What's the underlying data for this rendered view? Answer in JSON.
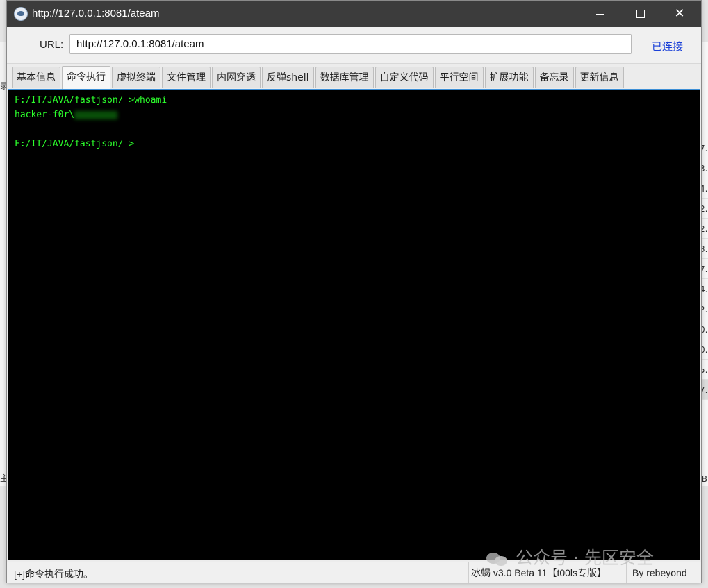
{
  "window": {
    "title": "http://127.0.0.1:8081/ateam",
    "icon": "shell-app-icon"
  },
  "urlbar": {
    "label": "URL:",
    "value": "http://127.0.0.1:8081/ateam",
    "status": "已连接",
    "status_color": "#1a40d8"
  },
  "tabs": [
    {
      "label": "基本信息"
    },
    {
      "label": "命令执行",
      "active": true
    },
    {
      "label": "虚拟终端"
    },
    {
      "label": "文件管理"
    },
    {
      "label": "内网穿透"
    },
    {
      "label": "反弹shell"
    },
    {
      "label": "数据库管理"
    },
    {
      "label": "自定义代码"
    },
    {
      "label": "平行空间"
    },
    {
      "label": "扩展功能"
    },
    {
      "label": "备忘录"
    },
    {
      "label": "更新信息"
    }
  ],
  "terminal": {
    "line1": "F:/IT/JAVA/fastjson/ >whoami",
    "line2": "hacker-f0r\\",
    "line3": "",
    "line4": "F:/IT/JAVA/fastjson/ >",
    "text_color": "#2cff2c",
    "background": "#000000"
  },
  "statusbar": {
    "message": "[+]命令执行成功。",
    "version": "冰蝎 v3.0 Beta 11【t00ls专版】",
    "author": "By rebeyond"
  },
  "background": {
    "left_labels": [
      "录",
      "主"
    ],
    "right_cells": [
      "7.",
      "3.",
      "4.",
      "2.",
      "2.",
      "3.",
      "7.",
      "4.",
      "2.",
      "0.",
      "0.",
      "5.",
      "7."
    ],
    "right_bottom": "B"
  },
  "watermark": {
    "text": "公众号 · 先区安全"
  }
}
